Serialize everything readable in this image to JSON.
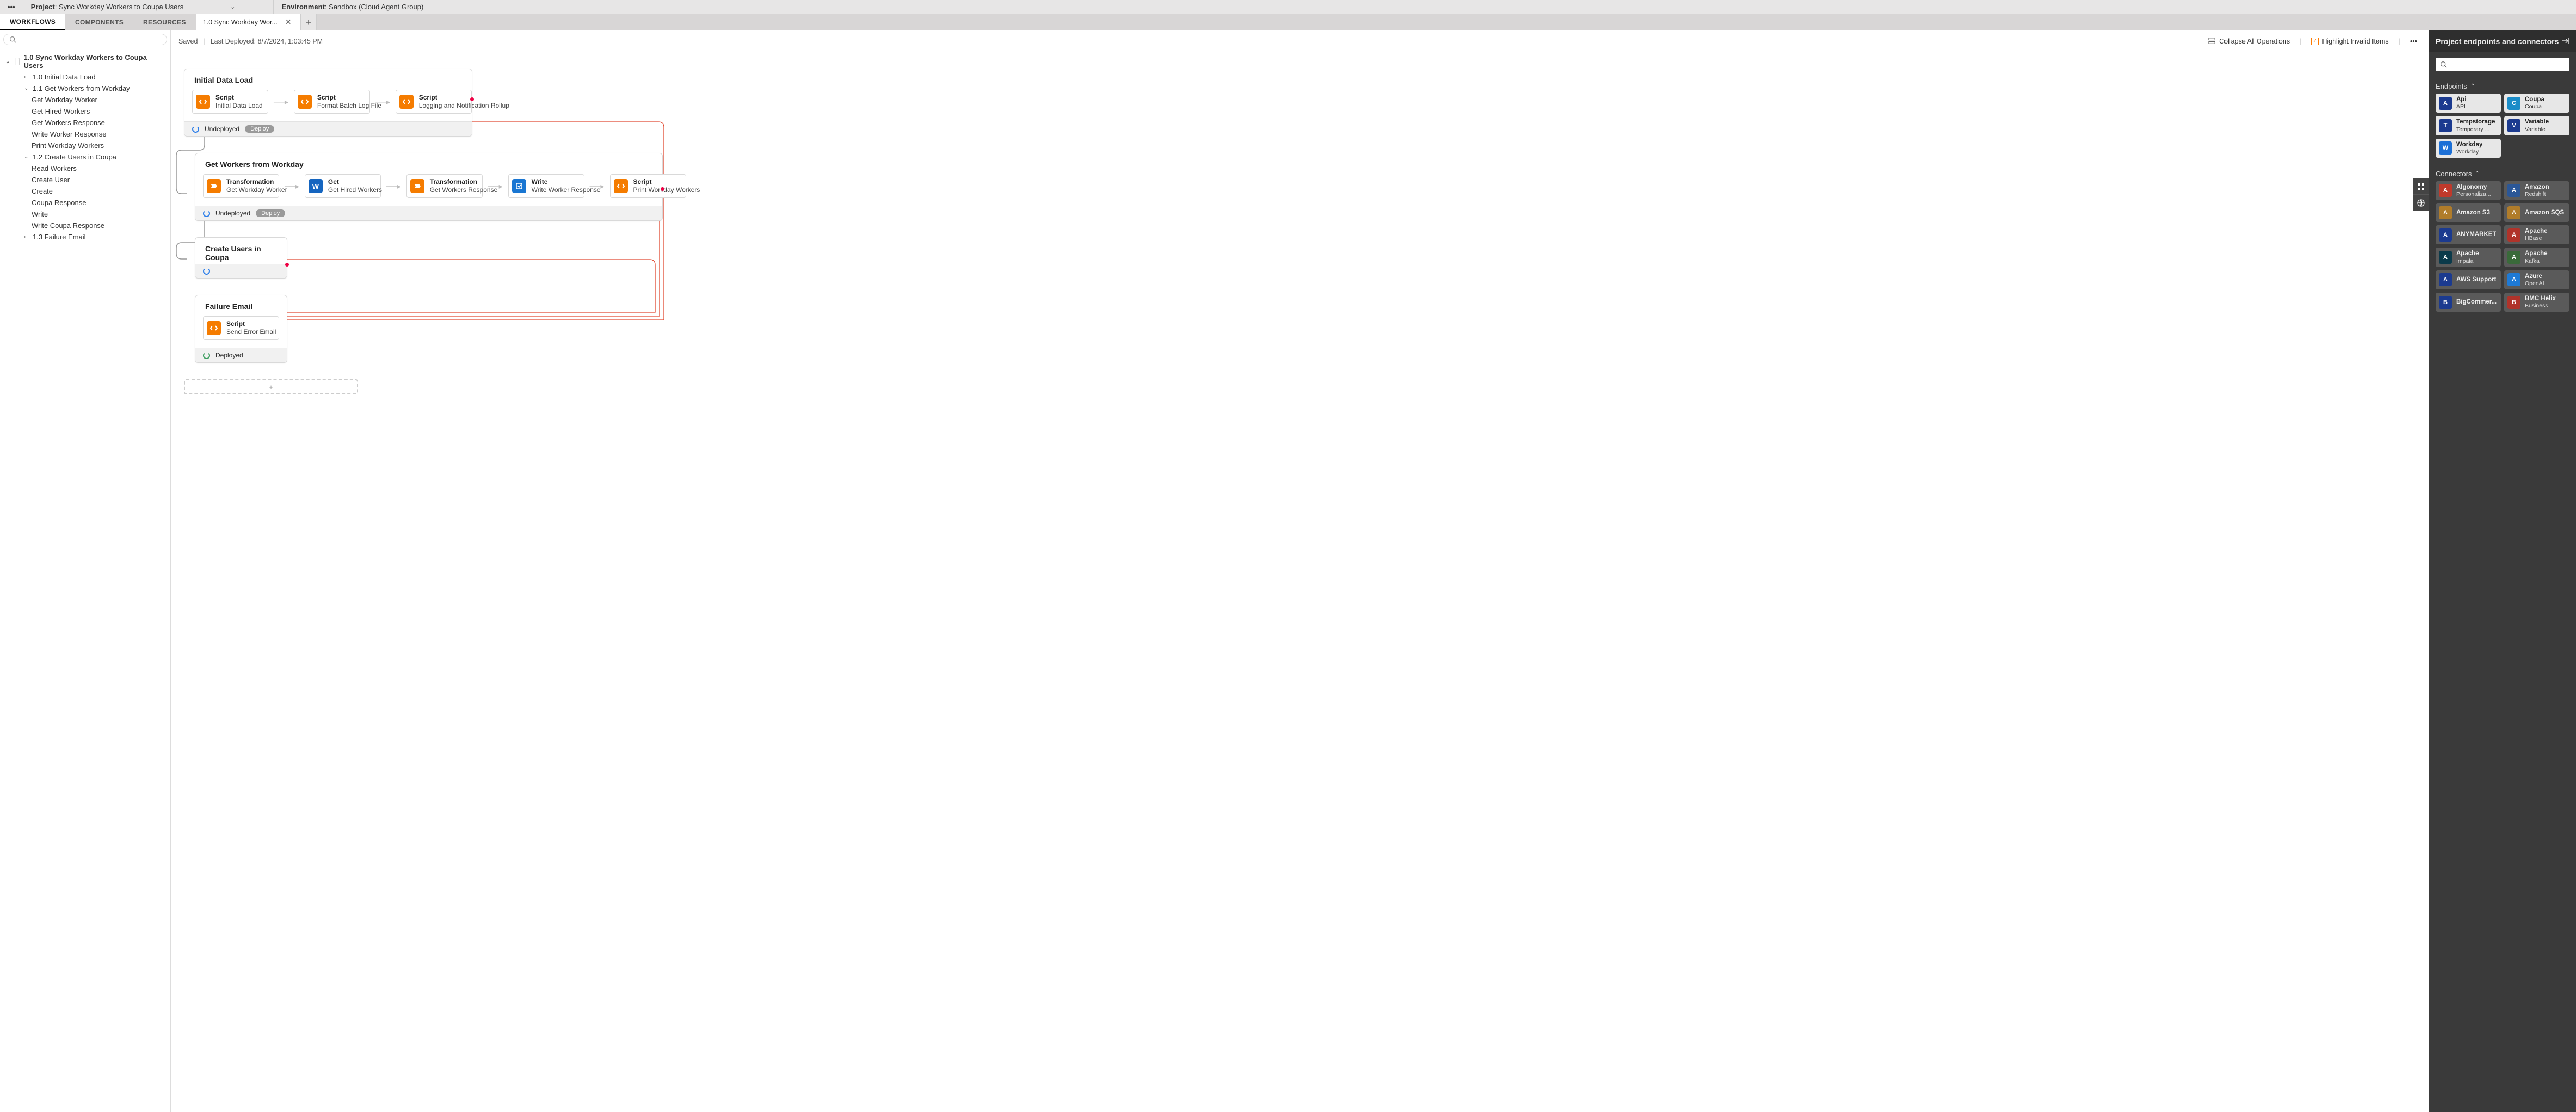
{
  "topbar": {
    "project_label": "Project",
    "project_name": "Sync Workday Workers to Coupa Users",
    "env_label": "Environment",
    "env_name": "Sandbox (Cloud Agent Group)"
  },
  "maintabs": [
    "WORKFLOWS",
    "COMPONENTS",
    "RESOURCES"
  ],
  "doctab": {
    "title": "1.0  Sync Workday Wor..."
  },
  "tree": {
    "root": "1.0 Sync Workday Workers to Coupa Users",
    "items": [
      {
        "id": "initial",
        "label": "1.0 Initial Data Load",
        "expanded": false
      },
      {
        "id": "getworkers",
        "label": "1.1 Get Workers from Workday",
        "expanded": true,
        "children": [
          "Get Workday Worker",
          "Get Hired Workers",
          "Get Workers Response",
          "Write Worker Response",
          "Print Workday Workers"
        ]
      },
      {
        "id": "coupa",
        "label": "1.2 Create Users in Coupa",
        "expanded": true,
        "children": [
          "Read Workers",
          "Create User",
          "Create",
          "Coupa Response",
          "Write",
          "Write Coupa Response"
        ]
      },
      {
        "id": "fail",
        "label": "1.3 Failure Email",
        "expanded": false
      }
    ]
  },
  "centerbar": {
    "saved": "Saved",
    "deployed": "Last Deployed: 8/7/2024, 1:03:45 PM",
    "collapse": "Collapse All Operations",
    "highlight": "Highlight Invalid Items"
  },
  "ops": [
    {
      "title": "Initial Data Load",
      "status": "Undeployed",
      "deploy_btn": "Deploy",
      "width": "med",
      "steps": [
        {
          "icon": "script",
          "t1": "Script",
          "t2": "Initial Data Load"
        },
        {
          "icon": "script",
          "t1": "Script",
          "t2": "Format Batch Log File"
        },
        {
          "icon": "script",
          "t1": "Script",
          "t2": "Logging and Notification Rollup"
        }
      ]
    },
    {
      "title": "Get Workers from Workday",
      "status": "Undeployed",
      "deploy_btn": "Deploy",
      "width": "wide",
      "steps": [
        {
          "icon": "xform",
          "t1": "Transformation",
          "t2": "Get Workday Worker"
        },
        {
          "icon": "w",
          "t1": "Get",
          "t2": "Get Hired Workers"
        },
        {
          "icon": "xform",
          "t1": "Transformation",
          "t2": "Get Workers Response"
        },
        {
          "icon": "wblue",
          "t1": "Write",
          "t2": "Write Worker Response"
        },
        {
          "icon": "script",
          "t1": "Script",
          "t2": "Print Workday Workers"
        }
      ]
    },
    {
      "title": "Create Users in Coupa",
      "status": "",
      "deploy_btn": "",
      "width": "small",
      "steps": []
    },
    {
      "title": "Failure Email",
      "status": "Deployed",
      "deploy_btn": "",
      "width": "small",
      "steps": [
        {
          "icon": "script",
          "t1": "Script",
          "t2": "Send Error Email"
        }
      ]
    }
  ],
  "rightpanel": {
    "title": "Project endpoints and connectors",
    "sections": {
      "endpoints_label": "Endpoints",
      "connectors_label": "Connectors"
    },
    "endpoints": [
      {
        "name": "Api",
        "sub": "API",
        "color": "#1b3a8f"
      },
      {
        "name": "Coupa",
        "sub": "Coupa",
        "color": "#1a8cc8"
      },
      {
        "name": "Tempstorage",
        "sub": "Temporary ...",
        "color": "#1b3a8f"
      },
      {
        "name": "Variable",
        "sub": "Variable",
        "color": "#1b3a8f"
      },
      {
        "name": "Workday",
        "sub": "Workday",
        "color": "#1b6fd6"
      }
    ],
    "connectors": [
      {
        "name": "Algonomy",
        "sub": "Personaliza...",
        "color": "#c0392b"
      },
      {
        "name": "Amazon",
        "sub": "Redshift",
        "color": "#2b5797"
      },
      {
        "name": "Amazon S3",
        "sub": "",
        "color": "#b07c2a"
      },
      {
        "name": "Amazon SQS",
        "sub": "",
        "color": "#b07c2a"
      },
      {
        "name": "ANYMARKET",
        "sub": "",
        "color": "#1b3a8f"
      },
      {
        "name": "Apache",
        "sub": "HBase",
        "color": "#b0332a"
      },
      {
        "name": "Apache",
        "sub": "Impala",
        "color": "#0b3a4a"
      },
      {
        "name": "Apache",
        "sub": "Kafka",
        "color": "#3a6a3a"
      },
      {
        "name": "AWS Support",
        "sub": "",
        "color": "#1b3a8f"
      },
      {
        "name": "Azure",
        "sub": "OpenAI",
        "color": "#1e7ad6"
      },
      {
        "name": "BigCommer...",
        "sub": "",
        "color": "#1b3a8f"
      },
      {
        "name": "BMC Helix",
        "sub": "Business",
        "color": "#b0332a"
      }
    ]
  }
}
